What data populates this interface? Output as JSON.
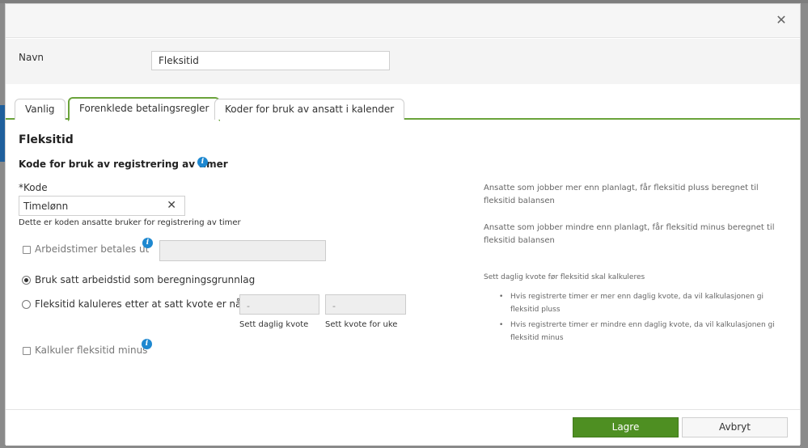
{
  "header": {
    "close_icon": "close-icon"
  },
  "name_field": {
    "label": "Navn",
    "value": "Fleksitid"
  },
  "tabs": [
    {
      "label": "Vanlig",
      "active": false
    },
    {
      "label": "Forenklede betalingsregler",
      "active": true
    },
    {
      "label": "Koder for bruk av ansatt i kalender",
      "active": false
    }
  ],
  "content": {
    "section_title": "Fleksitid",
    "subtitle": "Kode for bruk av registrering av timer",
    "code": {
      "label": "*Kode",
      "value": "Timelønn",
      "help": "Dette er koden ansatte bruker for registrering av timer"
    },
    "paid_hours": {
      "label": "Arbeidstimer betales ut",
      "checked": false,
      "value": ""
    },
    "radio_schedule": {
      "label": "Bruk satt arbeidstid som beregningsgrunnlag",
      "checked": true
    },
    "radio_quota": {
      "label": "Fleksitid kaluleres etter at satt kvote er nådd",
      "checked": false
    },
    "daily_quota": {
      "value": "-",
      "caption": "Sett daglig kvote"
    },
    "weekly_quota": {
      "value": "-",
      "caption": "Sett kvote for uke"
    },
    "calc_minus": {
      "label": "Kalkuler fleksitid minus",
      "checked": false
    }
  },
  "help_panel": {
    "plus_text": "Ansatte som jobber mer enn planlagt, får fleksitid pluss beregnet til fleksitid balansen",
    "minus_text": "Ansatte som jobber mindre enn planlagt, får fleksitid minus beregnet til fleksitid balansen",
    "quota_text": "Sett daglig kvote før fleksitid skal kalkuleres",
    "bullets": [
      "Hvis registrerte timer er mer enn daglig kvote, da vil kalkulasjonen gi fleksitid pluss",
      "Hvis registrerte timer er mindre enn daglig kvote, da vil kalkulasjonen gi fleksitid minus"
    ]
  },
  "footer": {
    "save_label": "Lagre",
    "cancel_label": "Avbryt"
  },
  "colors": {
    "accent_green": "#6aa33a",
    "save_button": "#4e8f22",
    "info_blue": "#1e88d0"
  }
}
